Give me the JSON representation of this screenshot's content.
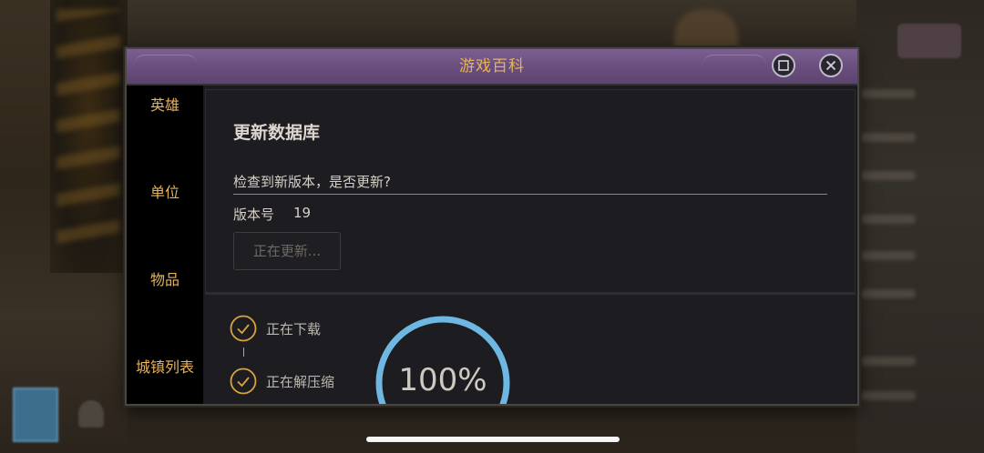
{
  "dialog": {
    "title": "游戏百科",
    "maximize_icon": "maximize-icon",
    "close_icon": "close-icon"
  },
  "sidebar": {
    "items": [
      {
        "label": "英雄"
      },
      {
        "label": "单位"
      },
      {
        "label": "物品"
      },
      {
        "label": "城镇列表"
      }
    ]
  },
  "update": {
    "section_title": "更新数据库",
    "prompt": "检查到新版本，是否更新?",
    "version_label": "版本号",
    "version_value": "19",
    "button_label": "正在更新..."
  },
  "progress": {
    "steps": [
      {
        "label": "正在下载",
        "done": true
      },
      {
        "label": "正在解压缩",
        "done": true
      }
    ],
    "percent_text": "100%",
    "percent": 100
  },
  "colors": {
    "accent_gold": "#e7b35a",
    "title_bar": "#6a4f7d",
    "progress_ring": "#6fb7e3",
    "check_circle": "#d6a33f"
  }
}
